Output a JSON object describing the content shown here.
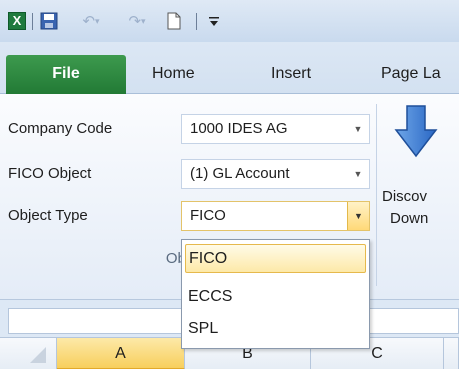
{
  "quick_access": {
    "excel_logo": "X",
    "icons": [
      "excel-icon",
      "save-icon",
      "undo-icon",
      "redo-icon",
      "new-document-icon",
      "customize-toolbar-icon"
    ]
  },
  "tabs": [
    {
      "label": "File"
    },
    {
      "label": "Home"
    },
    {
      "label": "Insert"
    },
    {
      "label": "Page La"
    }
  ],
  "ribbon": {
    "rows": [
      {
        "label": "Company Code",
        "value": "1000 IDES AG"
      },
      {
        "label": "FICO Object",
        "value": "(1) GL Account"
      },
      {
        "label": "Object Type",
        "value": "FICO"
      }
    ],
    "group_label": "Object",
    "discover_button": {
      "line1": "Discov",
      "line2": "Down"
    }
  },
  "dropdown": {
    "options": [
      "FICO",
      "ECCS",
      "SPL"
    ],
    "selected": "FICO"
  },
  "columns": [
    "A",
    "B",
    "C",
    ""
  ],
  "colors": {
    "file_tab": "#2e8b45",
    "highlight": "#f7cf5d",
    "ribbon_bg": "#dce7f4"
  }
}
